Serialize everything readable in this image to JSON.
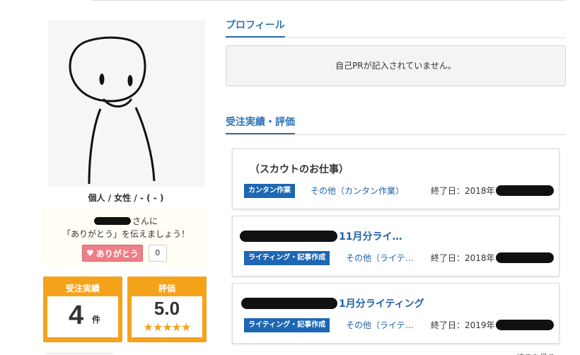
{
  "profile_user": {
    "info": "個人 / 女性 / - ( - )"
  },
  "thanks": {
    "suffix": "さんに",
    "message": "「ありがとう」を伝えましょう！",
    "button_label": "ありがとう",
    "count": "0"
  },
  "stats": {
    "orders": {
      "label": "受注実績",
      "value": "4",
      "unit": "件"
    },
    "rating": {
      "label": "評価",
      "value": "5.0",
      "stars": "★★★★★"
    }
  },
  "profile_section": {
    "title": "プロフィール",
    "pr_text": "自己PRが記入されていません。"
  },
  "orders_section": {
    "title": "受注実績・評価",
    "jobs": [
      {
        "title": "（スカウトのお仕事）",
        "tag": "カンタン作業",
        "category": "その他（カンタン作業）",
        "end_date": "終了日：2018年"
      },
      {
        "title": "11月分ライ…",
        "tag": "ライティング・記事作成",
        "category": "その他（ライテ…",
        "end_date": "終了日：2018年"
      },
      {
        "title": "1月分ライティング",
        "tag": "ライティング・記事作成",
        "category": "その他（ライテ…",
        "end_date": "終了日：2019年"
      }
    ],
    "more_label": "続きを見る"
  },
  "colors": {
    "accent_blue": "#2e74b5",
    "tag_blue": "#1d67b3",
    "stat_orange": "#f5a21b",
    "thanks_pink": "#ee7e87"
  }
}
